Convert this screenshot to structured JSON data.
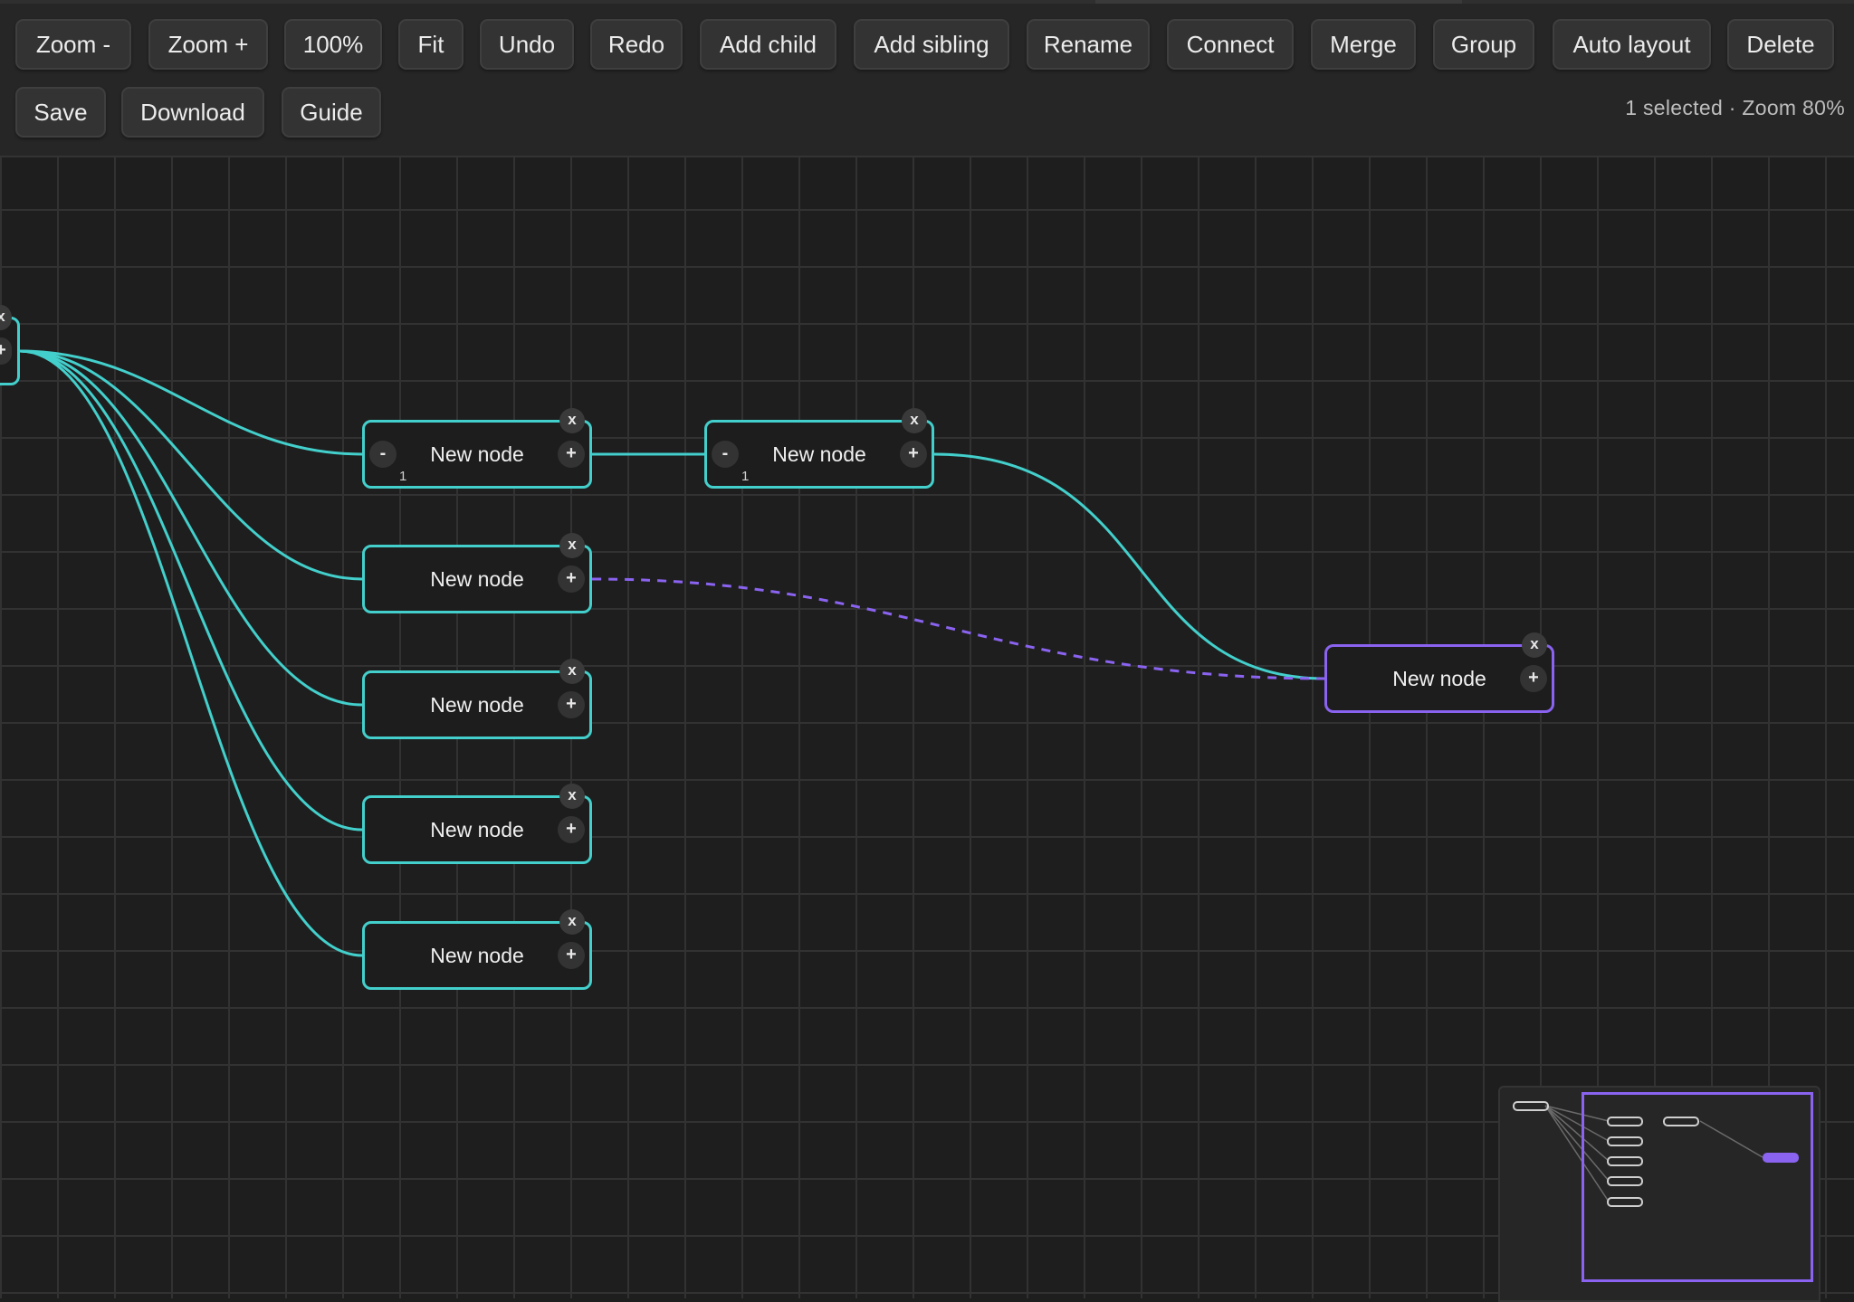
{
  "toolbar": {
    "row1": [
      {
        "id": "zoom-out-button",
        "label": "Zoom -"
      },
      {
        "id": "zoom-in-button",
        "label": "Zoom +"
      },
      {
        "id": "zoom-reset-button",
        "label": "100%"
      },
      {
        "id": "fit-button",
        "label": "Fit"
      },
      {
        "id": "undo-button",
        "label": "Undo"
      },
      {
        "id": "redo-button",
        "label": "Redo"
      },
      {
        "id": "add-child-button",
        "label": "Add child"
      },
      {
        "id": "add-sibling-button",
        "label": "Add sibling"
      },
      {
        "id": "rename-button",
        "label": "Rename"
      },
      {
        "id": "connect-button",
        "label": "Connect"
      },
      {
        "id": "merge-button",
        "label": "Merge"
      },
      {
        "id": "group-button",
        "label": "Group"
      },
      {
        "id": "auto-layout-button",
        "label": "Auto layout"
      },
      {
        "id": "delete-button",
        "label": "Delete"
      }
    ],
    "row2": [
      {
        "id": "save-button",
        "label": "Save"
      },
      {
        "id": "download-button",
        "label": "Download"
      },
      {
        "id": "guide-button",
        "label": "Guide"
      }
    ],
    "status": "1 selected · Zoom 80%"
  },
  "canvas": {
    "root_stub": {
      "close": "x",
      "plus": "+"
    },
    "nodes": [
      {
        "id": "n1",
        "label": "New node",
        "minus": "-",
        "plus": "+",
        "close": "x",
        "count": "1",
        "selected": false
      },
      {
        "id": "n2",
        "label": "New node",
        "plus": "+",
        "close": "x",
        "selected": false
      },
      {
        "id": "n3",
        "label": "New node",
        "plus": "+",
        "close": "x",
        "selected": false
      },
      {
        "id": "n4",
        "label": "New node",
        "plus": "+",
        "close": "x",
        "selected": false
      },
      {
        "id": "n5",
        "label": "New node",
        "plus": "+",
        "close": "x",
        "selected": false
      },
      {
        "id": "n6",
        "label": "New node",
        "minus": "-",
        "plus": "+",
        "close": "x",
        "count": "1",
        "selected": false
      },
      {
        "id": "n7",
        "label": "New node",
        "plus": "+",
        "close": "x",
        "selected": true
      }
    ],
    "edge_color": "#43cfcb",
    "link_color": "#8a63f0"
  },
  "minimap": {
    "viewport_color": "#8a63f0"
  }
}
